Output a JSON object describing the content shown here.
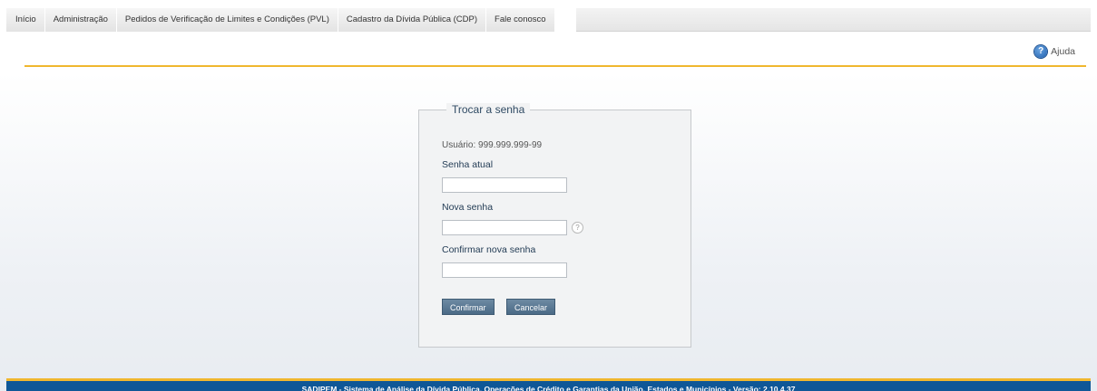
{
  "nav": {
    "items": [
      {
        "label": "Início"
      },
      {
        "label": "Administração"
      },
      {
        "label": "Pedidos de Verificação de Limites e Condições (PVL)"
      },
      {
        "label": "Cadastro da Dívida Pública (CDP)"
      },
      {
        "label": "Fale conosco"
      }
    ]
  },
  "help": {
    "label": "Ajuda"
  },
  "form": {
    "title": "Trocar a senha",
    "usuario": "Usuário: 999.999.999-99",
    "senha_atual_label": "Senha atual",
    "nova_senha_label": "Nova senha",
    "confirmar_label": "Confirmar nova senha",
    "senha_atual_value": "",
    "nova_senha_value": "",
    "confirmar_value": "",
    "confirm_button": "Confirmar",
    "cancel_button": "Cancelar",
    "help_icon": "?"
  },
  "footer": {
    "text": "SADIPEM - Sistema de Análise da Dívida Pública, Operações de Crédito e Garantias da União, Estados e Municípios - Versão: 2.10.4.37"
  },
  "colors": {
    "accent": "#f0b72f",
    "footer": "#0f5797",
    "button": "#4b6a86"
  }
}
